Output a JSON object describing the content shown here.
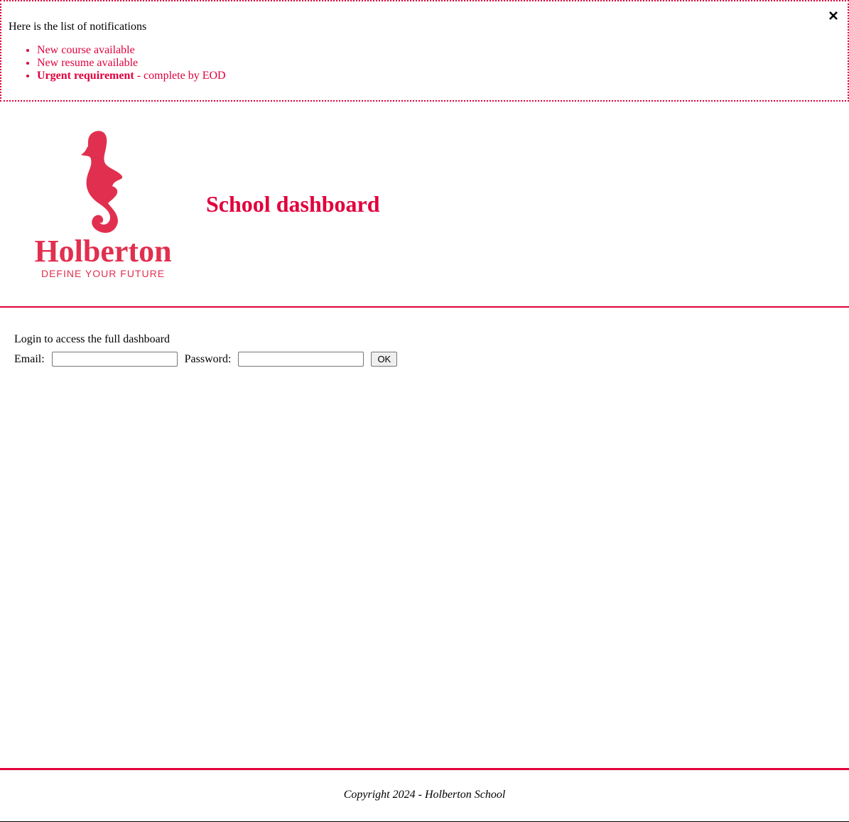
{
  "notifications": {
    "intro": "Here is the list of notifications",
    "items": [
      {
        "text": "New course available"
      },
      {
        "text": "New resume available"
      },
      {
        "bold": "Urgent requirement",
        "rest": " - complete by EOD"
      }
    ],
    "close_icon": "close-icon"
  },
  "header": {
    "logo": {
      "name": "Holberton",
      "tagline": "DEFINE YOUR FUTURE",
      "icon": "seahorse-icon"
    },
    "title": "School dashboard"
  },
  "body": {
    "login_text": "Login to access the full dashboard",
    "email_label": "Email:",
    "email_value": "",
    "password_label": "Password:",
    "password_value": "",
    "ok_label": "OK"
  },
  "footer": {
    "copyright": "Copyright 2024 - Holberton School"
  },
  "colors": {
    "accent": "#e1003c",
    "logo": "#e1304f"
  }
}
